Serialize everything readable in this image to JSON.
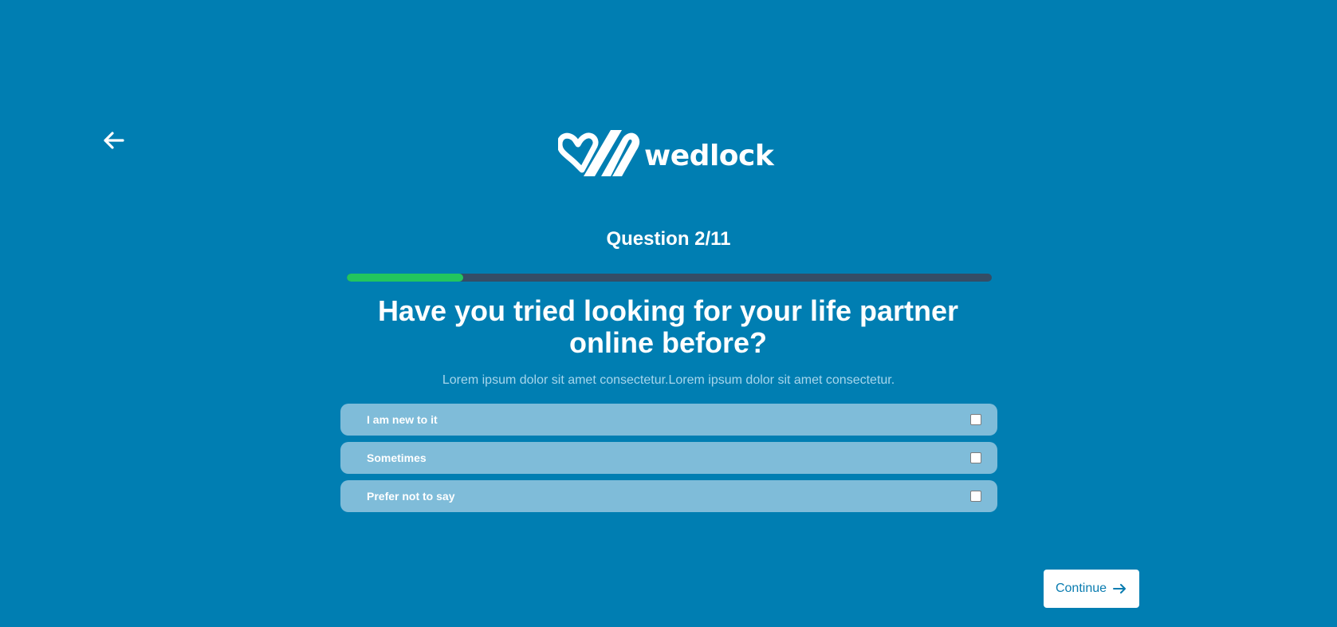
{
  "nav": {
    "back_icon": "arrow-left-icon"
  },
  "logo": {
    "text": "wedlock",
    "icon": "wedlock-logo-mark"
  },
  "quiz": {
    "counter": "Question 2/11",
    "progress": 0.18,
    "question": "Have you tried looking for your life partner online before?",
    "subtitle": "Lorem ipsum dolor sit amet consectetur.Lorem ipsum dolor sit amet consectetur.",
    "options": [
      {
        "label": "I am new to it",
        "checked": false
      },
      {
        "label": "Sometimes",
        "checked": false
      },
      {
        "label": "Prefer not to say",
        "checked": false
      }
    ]
  },
  "footer": {
    "continue_label": "Continue",
    "continue_icon": "arrow-right-icon"
  },
  "colors": {
    "background": "#007eb2",
    "progress_fill": "#22c55e",
    "progress_track": "#344d66",
    "option_bg": "#7fbcd9",
    "button_text": "#0a7cb0"
  }
}
